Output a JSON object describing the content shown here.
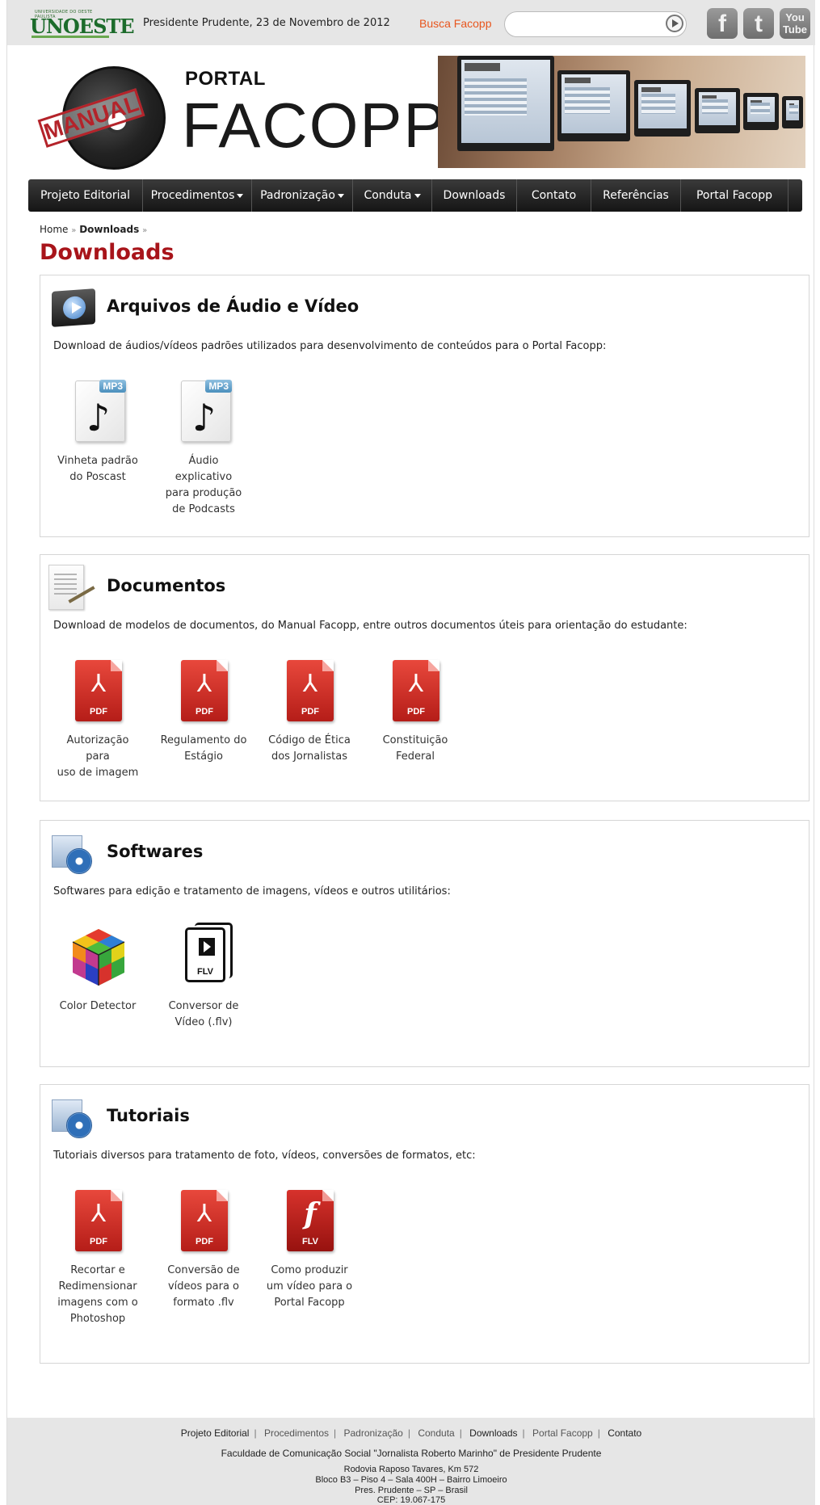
{
  "topbar": {
    "logo_small": "UNIVERSIDADE DO OESTE PAULISTA",
    "logo_big": "UNOESTE",
    "date": "Presidente Prudente, 23 de Novembro de 2012",
    "search_label": "Busca Facopp",
    "search_placeholder": "",
    "social": {
      "facebook": "f",
      "twitter": "t",
      "youtube_1": "You",
      "youtube_2": "Tube"
    }
  },
  "header": {
    "stamp": "MANUAL",
    "portal_small": "PORTAL",
    "portal_big": "FACOPP"
  },
  "nav": {
    "items": [
      {
        "label": "Projeto Editorial",
        "dropdown": false
      },
      {
        "label": "Procedimentos",
        "dropdown": true
      },
      {
        "label": "Padronização",
        "dropdown": true
      },
      {
        "label": "Conduta",
        "dropdown": true
      },
      {
        "label": "Downloads",
        "dropdown": false
      },
      {
        "label": "Contato",
        "dropdown": false
      },
      {
        "label": "Referências",
        "dropdown": false
      },
      {
        "label": "Portal Facopp",
        "dropdown": false
      }
    ]
  },
  "breadcrumb": {
    "home": "Home",
    "sep": "»",
    "current": "Downloads"
  },
  "page_title": "Downloads",
  "sections": [
    {
      "title": "Arquivos de Áudio e Vídeo",
      "desc": "Download de áudios/vídeos padrões utilizados para desenvolvimento de conteúdos para o Portal Facopp:",
      "items": [
        {
          "type": "mp3",
          "lines": [
            "Vinheta padrão",
            "do Poscast"
          ]
        },
        {
          "type": "mp3",
          "lines": [
            "Áudio explicativo",
            "para produção",
            "de Podcasts"
          ]
        }
      ]
    },
    {
      "title": "Documentos",
      "desc": "Download de modelos de documentos, do Manual Facopp, entre outros documentos úteis para orientação do estudante:",
      "items": [
        {
          "type": "pdf",
          "lines": [
            "Autorização para",
            "uso de imagem"
          ]
        },
        {
          "type": "pdf",
          "lines": [
            "Regulamento do",
            "Estágio"
          ]
        },
        {
          "type": "pdf",
          "lines": [
            "Código de Ética",
            "dos Jornalistas"
          ]
        },
        {
          "type": "pdf",
          "lines": [
            "Constituição",
            "Federal"
          ]
        }
      ]
    },
    {
      "title": "Softwares",
      "desc": "Softwares para edição e tratamento de imagens, vídeos e outros utilitários:",
      "items": [
        {
          "type": "cube",
          "lines": [
            "Color Detector"
          ]
        },
        {
          "type": "flv-outline",
          "lines": [
            "Conversor de",
            "Vídeo (.flv)"
          ]
        }
      ]
    },
    {
      "title": "Tutoriais",
      "desc": "Tutoriais diversos para tratamento de foto, vídeos, conversões de formatos, etc:",
      "items": [
        {
          "type": "pdf",
          "lines": [
            "Recortar e",
            "Redimensionar",
            "imagens com o",
            "Photoshop"
          ]
        },
        {
          "type": "pdf",
          "lines": [
            "Conversão de",
            "vídeos para o",
            "formato .flv"
          ]
        },
        {
          "type": "flv-red",
          "lines": [
            "Como produzir",
            "um vídeo para o",
            "Portal Facopp"
          ]
        }
      ]
    }
  ],
  "icon_labels": {
    "pdf": "PDF",
    "mp3": "MP3",
    "flv": "FLV"
  },
  "footer": {
    "links": [
      {
        "label": "Projeto Editorial",
        "hi": true
      },
      {
        "label": "Procedimentos",
        "hi": false
      },
      {
        "label": "Padronização",
        "hi": false
      },
      {
        "label": "Conduta",
        "hi": false
      },
      {
        "label": "Downloads",
        "hi": true
      },
      {
        "label": "Portal Facopp",
        "hi": false
      },
      {
        "label": "Contato",
        "hi": true
      }
    ],
    "institution": "Faculdade de Comunicação Social \"Jornalista Roberto Marinho\" de Presidente Prudente",
    "address_1": "Rodovia Raposo Tavares, Km 572",
    "address_2": "Bloco B3 – Piso 4 – Sala 400H – Bairro Limoeiro",
    "address_3": "Pres. Prudente – SP – Brasil",
    "address_4": "CEP: 19.067-175"
  },
  "colors": {
    "title_red": "#a8141a",
    "busca_orange": "#e8561e",
    "nav_dark": "#1c1c1c",
    "unoeste_green": "#1c6b2b"
  }
}
